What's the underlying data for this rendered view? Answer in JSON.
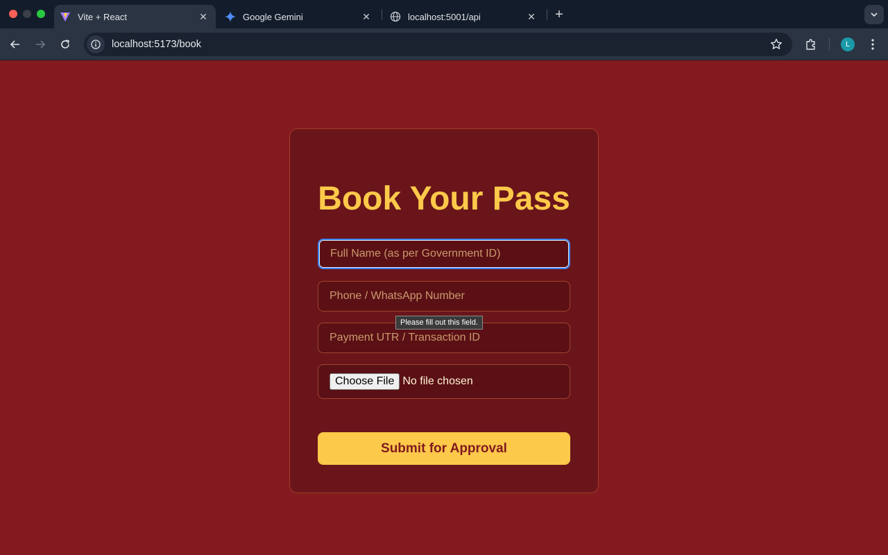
{
  "browser": {
    "tabs": [
      {
        "title": "Vite + React",
        "favicon": "vite-icon",
        "active": true
      },
      {
        "title": "Google Gemini",
        "favicon": "gemini-icon",
        "active": false
      },
      {
        "title": "localhost:5001/api",
        "favicon": "globe-icon",
        "active": false
      }
    ],
    "address": "localhost:5173/book",
    "profile_initial": "L",
    "colors": {
      "tabbar": "#131c2a",
      "toolbar": "#2a3442",
      "avatar": "#1a9aa8"
    }
  },
  "page": {
    "title": "Book Your Pass",
    "fields": {
      "full_name": {
        "placeholder": "Full Name (as per Government ID)",
        "value": ""
      },
      "phone": {
        "placeholder": "Phone / WhatsApp Number",
        "value": ""
      },
      "utr": {
        "placeholder": "Payment UTR / Transaction ID",
        "value": ""
      }
    },
    "file": {
      "button_label": "Choose File",
      "status": "No file chosen"
    },
    "submit_label": "Submit for Approval",
    "validation_tooltip": "Please fill out this field.",
    "colors": {
      "background": "#821a1f",
      "card": "#6a151a",
      "accent": "#fdc94a",
      "focus": "#3b82f6"
    }
  }
}
